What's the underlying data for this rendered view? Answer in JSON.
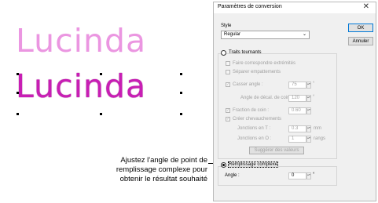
{
  "samples": {
    "text_top": "Lucinda",
    "text_bottom": "Lucinda"
  },
  "callout": {
    "line1": "Ajustez l'angle de point de",
    "line2": "remplissage complexe pour",
    "line3": "obtenir le résultat souhaité"
  },
  "dialog": {
    "title": "Paramètres de conversion",
    "close": "✕",
    "style_label": "Style",
    "style_value": "Regular",
    "ok_label": "OK",
    "cancel_label": "Annuler",
    "turning_label": "Traits tournants",
    "match_ends_label": "Faire correspondre extrémités",
    "separate_serifs_label": "Séparer empattements",
    "break_angle_label": "Casser angle :",
    "break_angle_value": "75",
    "corner_offset_label": "Angle de décal. de coin :",
    "corner_offset_value": "120",
    "corner_fraction_label": "Fraction de coin :",
    "corner_fraction_value": "0.60",
    "overlaps_label": "Créer chevauchements",
    "join_t_label": "Jonctions en T :",
    "join_t_value": "0.3",
    "join_t_unit": "mm",
    "join_o_label": "Jonctions en O :",
    "join_o_value": "1",
    "join_o_unit": "rangs",
    "suggest_label": "Suggérer des valeurs",
    "complex_fill_label": "Remplissage complexe",
    "angle_label": "Angle :",
    "angle_value": "0",
    "degree": "°"
  }
}
